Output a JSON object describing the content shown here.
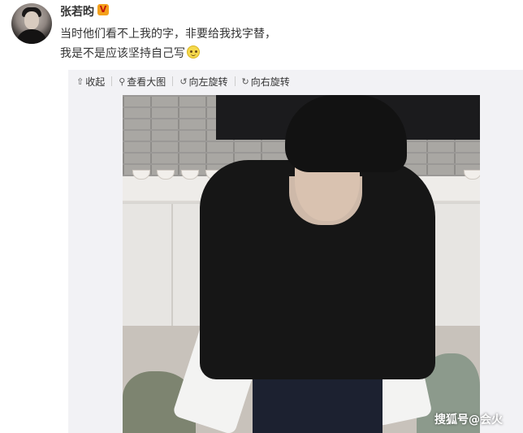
{
  "post": {
    "username": "张若昀",
    "verified_badge": "V",
    "lines": [
      "当时他们看不上我的字，非要给我找字替，",
      "我是不是应该坚持自己写"
    ],
    "emoji": "smile-emoji"
  },
  "toolbar": {
    "collapse": {
      "icon": "⇧",
      "label": "收起"
    },
    "view_large": {
      "icon": "⚲",
      "label": "查看大图"
    },
    "rotate_left": {
      "icon": "↺",
      "label": "向左旋转"
    },
    "rotate_right": {
      "icon": "↻",
      "label": "向右旋转"
    }
  },
  "watermark": "搜狐号@会火",
  "colors": {
    "accent_badge": "#f4a11c",
    "toolbar_bg": "#f2f2f5",
    "text": "#333333"
  }
}
